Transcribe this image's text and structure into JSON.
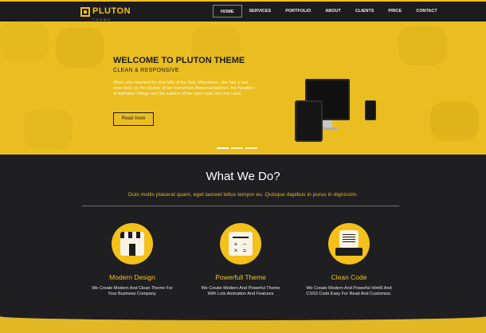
{
  "logo": {
    "name": "PLUTON",
    "sub": "THEME"
  },
  "menu": [
    {
      "label": "HOME"
    },
    {
      "label": "SERVICES"
    },
    {
      "label": "PORTFOLIO"
    },
    {
      "label": "ABOUT"
    },
    {
      "label": "CLIENTS"
    },
    {
      "label": "PRICE"
    },
    {
      "label": "CONTACT"
    }
  ],
  "hero": {
    "title": "WELCOME TO PLUTON THEME",
    "subtitle": "CLEAN & RESPONSIVE",
    "text": "When she reached the first hills of the Italic Mountains, she had a last view back on the skyline of her hometown Bookmarksgrove, the headline of Alphabet Village and the subline of her own road, the Line Lane.",
    "button": "Read more"
  },
  "section": {
    "title": "What We Do?",
    "subtitle": "Duis mollis placerat quam, eget laoreet tellus tempor eu. Quisque dapibus in purus in dignissim."
  },
  "services": [
    {
      "title": "Modern Design",
      "text": "We Create Modern And Clean Theme For Your Business Company.",
      "icon": "shop-icon"
    },
    {
      "title": "Powerfull Theme",
      "text": "We Create Modern And Powerful Theme With Lots Animation And Features",
      "icon": "calculator-icon"
    },
    {
      "title": "Clean Code",
      "text": "We Create Modern And Powerful Html5 And CSS3 Code Easy For Read And Customize.",
      "icon": "code-icon"
    }
  ],
  "colors": {
    "accent": "#f4c01a",
    "dark": "#1f1f22"
  }
}
